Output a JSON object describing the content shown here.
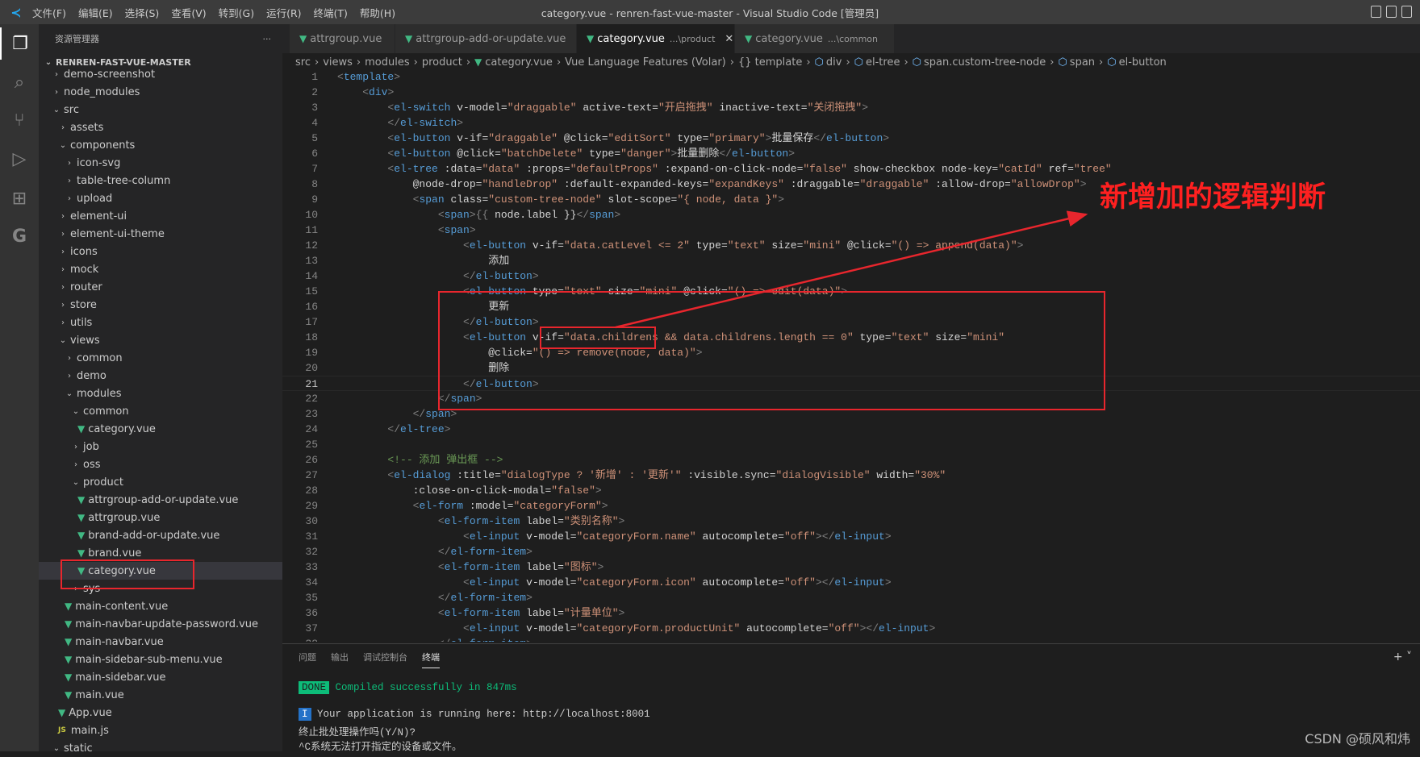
{
  "titlebar": {
    "menu": [
      "文件(F)",
      "编辑(E)",
      "选择(S)",
      "查看(V)",
      "转到(G)",
      "运行(R)",
      "终端(T)",
      "帮助(H)"
    ],
    "title": "category.vue - renren-fast-vue-master - Visual Studio Code [管理员]"
  },
  "sidebar": {
    "title": "资源管理器",
    "more": "···",
    "root": "RENREN-FAST-VUE-MASTER",
    "items": [
      {
        "label": "demo-screenshot",
        "level": 0,
        "type": "folder",
        "open": false
      },
      {
        "label": "node_modules",
        "level": 0,
        "type": "folder",
        "open": false
      },
      {
        "label": "src",
        "level": 0,
        "type": "folder",
        "open": true
      },
      {
        "label": "assets",
        "level": 1,
        "type": "folder",
        "open": false
      },
      {
        "label": "components",
        "level": 1,
        "type": "folder",
        "open": true
      },
      {
        "label": "icon-svg",
        "level": 2,
        "type": "folder",
        "open": false
      },
      {
        "label": "table-tree-column",
        "level": 2,
        "type": "folder",
        "open": false
      },
      {
        "label": "upload",
        "level": 2,
        "type": "folder",
        "open": false
      },
      {
        "label": "element-ui",
        "level": 1,
        "type": "folder",
        "open": false
      },
      {
        "label": "element-ui-theme",
        "level": 1,
        "type": "folder",
        "open": false
      },
      {
        "label": "icons",
        "level": 1,
        "type": "folder",
        "open": false
      },
      {
        "label": "mock",
        "level": 1,
        "type": "folder",
        "open": false
      },
      {
        "label": "router",
        "level": 1,
        "type": "folder",
        "open": false
      },
      {
        "label": "store",
        "level": 1,
        "type": "folder",
        "open": false
      },
      {
        "label": "utils",
        "level": 1,
        "type": "folder",
        "open": false
      },
      {
        "label": "views",
        "level": 1,
        "type": "folder",
        "open": true
      },
      {
        "label": "common",
        "level": 2,
        "type": "folder",
        "open": false
      },
      {
        "label": "demo",
        "level": 2,
        "type": "folder",
        "open": false
      },
      {
        "label": "modules",
        "level": 2,
        "type": "folder",
        "open": true
      },
      {
        "label": "common",
        "level": 3,
        "type": "folder",
        "open": true
      },
      {
        "label": "category.vue",
        "level": 4,
        "type": "vue"
      },
      {
        "label": "job",
        "level": 3,
        "type": "folder",
        "open": false
      },
      {
        "label": "oss",
        "level": 3,
        "type": "folder",
        "open": false
      },
      {
        "label": "product",
        "level": 3,
        "type": "folder",
        "open": true
      },
      {
        "label": "attrgroup-add-or-update.vue",
        "level": 4,
        "type": "vue"
      },
      {
        "label": "attrgroup.vue",
        "level": 4,
        "type": "vue"
      },
      {
        "label": "brand-add-or-update.vue",
        "level": 4,
        "type": "vue"
      },
      {
        "label": "brand.vue",
        "level": 4,
        "type": "vue"
      },
      {
        "label": "category.vue",
        "level": 4,
        "type": "vue",
        "selected": true
      },
      {
        "label": "sys",
        "level": 3,
        "type": "folder",
        "open": false
      },
      {
        "label": "main-content.vue",
        "level": 2,
        "type": "vue"
      },
      {
        "label": "main-navbar-update-password.vue",
        "level": 2,
        "type": "vue"
      },
      {
        "label": "main-navbar.vue",
        "level": 2,
        "type": "vue"
      },
      {
        "label": "main-sidebar-sub-menu.vue",
        "level": 2,
        "type": "vue"
      },
      {
        "label": "main-sidebar.vue",
        "level": 2,
        "type": "vue"
      },
      {
        "label": "main.vue",
        "level": 2,
        "type": "vue"
      },
      {
        "label": "App.vue",
        "level": 1,
        "type": "vue"
      },
      {
        "label": "main.js",
        "level": 1,
        "type": "js"
      },
      {
        "label": "static",
        "level": 0,
        "type": "folder",
        "open": true
      }
    ]
  },
  "tabs": [
    {
      "label": "attrgroup.vue",
      "desc": "",
      "active": false
    },
    {
      "label": "attrgroup-add-or-update.vue",
      "desc": "",
      "active": false
    },
    {
      "label": "category.vue",
      "desc": "...\\product",
      "active": true,
      "close": "✕"
    },
    {
      "label": "category.vue",
      "desc": "...\\common",
      "active": false
    }
  ],
  "breadcrumb": [
    "src",
    "views",
    "modules",
    "product",
    "category.vue",
    "Vue Language Features (Volar)",
    "{} template",
    "div",
    "el-tree",
    "span.custom-tree-node",
    "span",
    "el-button"
  ],
  "editor": {
    "current_line": 21,
    "lines": [
      "<template>",
      "    <div>",
      "        <el-switch v-model=\"draggable\" active-text=\"开启拖拽\" inactive-text=\"关闭拖拽\">",
      "        </el-switch>",
      "        <el-button v-if=\"draggable\" @click=\"editSort\" type=\"primary\">批量保存</el-button>",
      "        <el-button @click=\"batchDelete\" type=\"danger\">批量删除</el-button>",
      "        <el-tree :data=\"data\" :props=\"defaultProps\" :expand-on-click-node=\"false\" show-checkbox node-key=\"catId\" ref=\"tree\"",
      "            @node-drop=\"handleDrop\" :default-expanded-keys=\"expandKeys\" :draggable=\"draggable\" :allow-drop=\"allowDrop\">",
      "            <span class=\"custom-tree-node\" slot-scope=\"{ node, data }\">",
      "                <span>{{ node.label }}</span>",
      "                <span>",
      "                    <el-button v-if=\"data.catLevel <= 2\" type=\"text\" size=\"mini\" @click=\"() => append(data)\">",
      "                        添加",
      "                    </el-button>",
      "                    <el-button type=\"text\" size=\"mini\" @click=\"() => edit(data)\">",
      "                        更新",
      "                    </el-button>",
      "                    <el-button v-if=\"data.childrens && data.childrens.length == 0\" type=\"text\" size=\"mini\"",
      "                        @click=\"() => remove(node, data)\">",
      "                        删除",
      "                    </el-button>",
      "                </span>",
      "            </span>",
      "        </el-tree>",
      "",
      "        <!-- 添加 弹出框 -->",
      "        <el-dialog :title=\"dialogType ? '新增' : '更新'\" :visible.sync=\"dialogVisible\" width=\"30%\"",
      "            :close-on-click-modal=\"false\">",
      "            <el-form :model=\"categoryForm\">",
      "                <el-form-item label=\"类别名称\">",
      "                    <el-input v-model=\"categoryForm.name\" autocomplete=\"off\"></el-input>",
      "                </el-form-item>",
      "                <el-form-item label=\"图标\">",
      "                    <el-input v-model=\"categoryForm.icon\" autocomplete=\"off\"></el-input>",
      "                </el-form-item>",
      "                <el-form-item label=\"计量单位\">",
      "                    <el-input v-model=\"categoryForm.productUnit\" autocomplete=\"off\"></el-input>",
      "                </el-form-item>"
    ]
  },
  "panel": {
    "tabs": [
      "问题",
      "输出",
      "调试控制台",
      "终端"
    ],
    "active_tab": "终端",
    "actions": "+ ˅",
    "terminal": {
      "done_badge": "DONE",
      "done_text": "Compiled successfully in 847ms",
      "info_badge": "I",
      "info_text": "Your application is running here: http://localhost:8001",
      "line3": "终止批处理操作吗(Y/N)?",
      "line4": "^C系统无法打开指定的设备或文件。"
    }
  },
  "annotation": {
    "text": "新增加的逻辑判断",
    "color": "#e8262d"
  },
  "watermark": "CSDN @硕风和炜"
}
